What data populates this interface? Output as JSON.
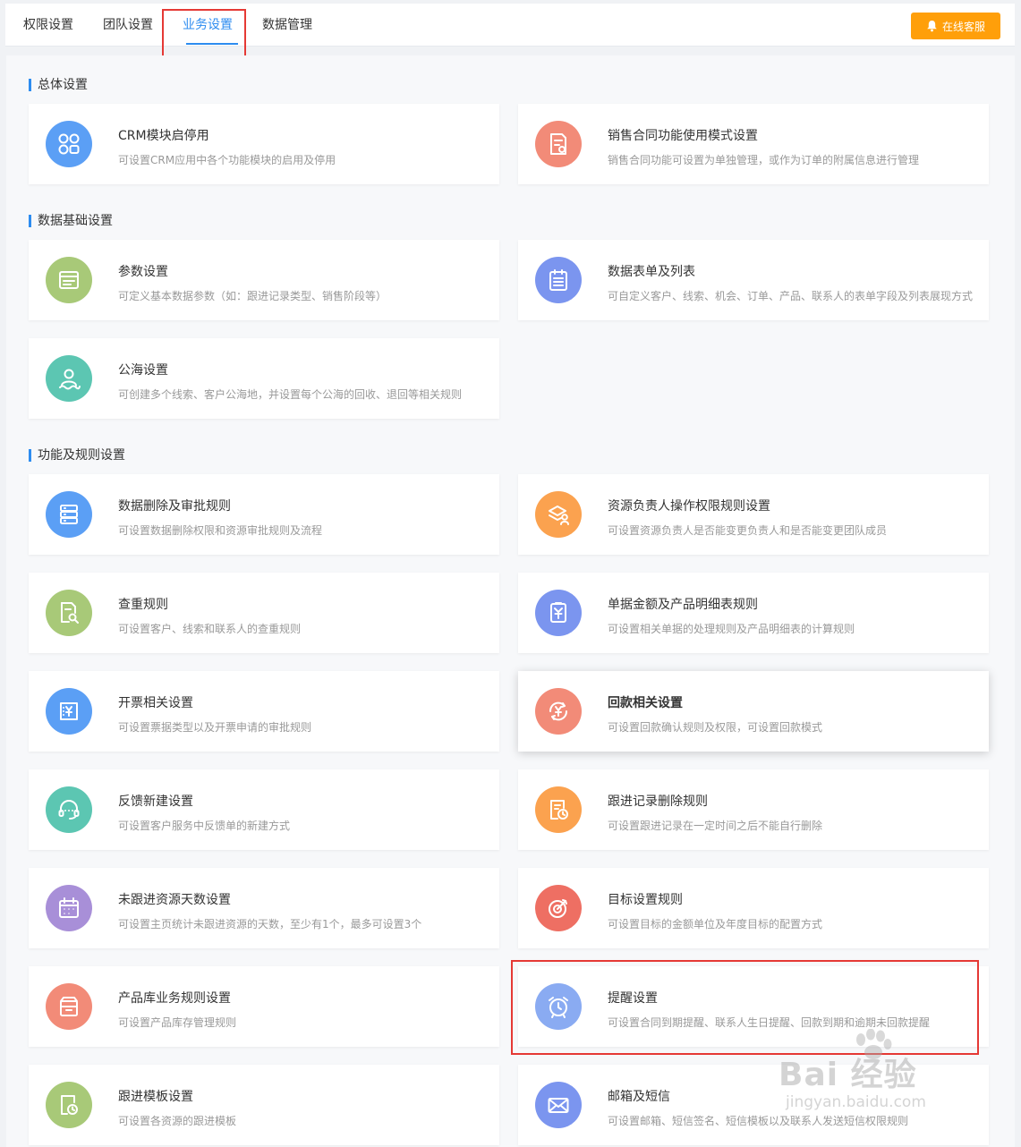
{
  "tabs": [
    "权限设置",
    "团队设置",
    "业务设置",
    "数据管理"
  ],
  "active_tab": "业务设置",
  "support_button": "在线客服",
  "sections": {
    "general": "总体设置",
    "data_base": "数据基础设置",
    "rules": "功能及规则设置"
  },
  "cards": [
    {
      "title": "CRM模块启停用",
      "desc": "可设置CRM应用中各个功能模块的启用及停用",
      "color": "#5b9ff5",
      "icon": "modules-icon"
    },
    {
      "title": "销售合同功能使用模式设置",
      "desc": "销售合同功能可设置为单独管理，或作为订单的附属信息进行管理",
      "color": "#f28b78",
      "icon": "contract-icon"
    },
    {
      "title": "参数设置",
      "desc": "可定义基本数据参数（如：跟进记录类型、销售阶段等）",
      "color": "#a8c978",
      "icon": "form-icon"
    },
    {
      "title": "数据表单及列表",
      "desc": "可自定义客户、线索、机会、订单、产品、联系人的表单字段及列表展现方式",
      "color": "#7b95ef",
      "icon": "clipboard-list-icon"
    },
    {
      "title": "公海设置",
      "desc": "可创建多个线索、客户公海地，并设置每个公海的回收、退回等相关规则",
      "color": "#5cc6b2",
      "icon": "user-sea-icon"
    },
    {
      "title": "数据删除及审批规则",
      "desc": "可设置数据删除权限和资源审批规则及流程",
      "color": "#5b9ff5",
      "icon": "server-icon"
    },
    {
      "title": "资源负责人操作权限规则设置",
      "desc": "可设置资源负责人是否能变更负责人和是否能变更团队成员",
      "color": "#fba24f",
      "icon": "layers-user-icon"
    },
    {
      "title": "查重规则",
      "desc": "可设置客户、线索和联系人的查重规则",
      "color": "#a8c978",
      "icon": "doc-search-icon"
    },
    {
      "title": "单据金额及产品明细表规则",
      "desc": "可设置相关单据的处理规则及产品明细表的计算规则",
      "color": "#7b95ef",
      "icon": "yen-doc-icon"
    },
    {
      "title": "开票相关设置",
      "desc": "可设置票据类型以及开票申请的审批规则",
      "color": "#5b9ff5",
      "icon": "invoice-icon"
    },
    {
      "title": "回款相关设置",
      "desc": "可设置回款确认规则及权限，可设置回款模式",
      "color": "#f28b78",
      "icon": "yen-cycle-icon"
    },
    {
      "title": "反馈新建设置",
      "desc": "可设置客户服务中反馈单的新建方式",
      "color": "#5cc6b2",
      "icon": "headset-icon"
    },
    {
      "title": "跟进记录删除规则",
      "desc": "可设置跟进记录在一定时间之后不能自行删除",
      "color": "#fba24f",
      "icon": "doc-clock-icon"
    },
    {
      "title": "未跟进资源天数设置",
      "desc": "可设置主页统计未跟进资源的天数，至少有1个，最多可设置3个",
      "color": "#a88fd8",
      "icon": "calendar-icon"
    },
    {
      "title": "目标设置规则",
      "desc": "可设置目标的金额单位及年度目标的配置方式",
      "color": "#ee6f63",
      "icon": "target-icon"
    },
    {
      "title": "产品库业务规则设置",
      "desc": "可设置产品库存管理规则",
      "color": "#f28b78",
      "icon": "box-icon"
    },
    {
      "title": "提醒设置",
      "desc": "可设置合同到期提醒、联系人生日提醒、回款到期和逾期未回款提醒",
      "color": "#8aabf2",
      "icon": "alarm-clock-icon"
    },
    {
      "title": "跟进模板设置",
      "desc": "可设置各资源的跟进模板",
      "color": "#a8c978",
      "icon": "template-clock-icon"
    },
    {
      "title": "邮箱及短信",
      "desc": "可设置邮箱、短信签名、短信模板以及联系人发送短信权限规则",
      "color": "#7b95ef",
      "icon": "mail-icon"
    }
  ],
  "watermark": {
    "main": "Bai 经验",
    "sub": "jingyan.baidu.com"
  }
}
